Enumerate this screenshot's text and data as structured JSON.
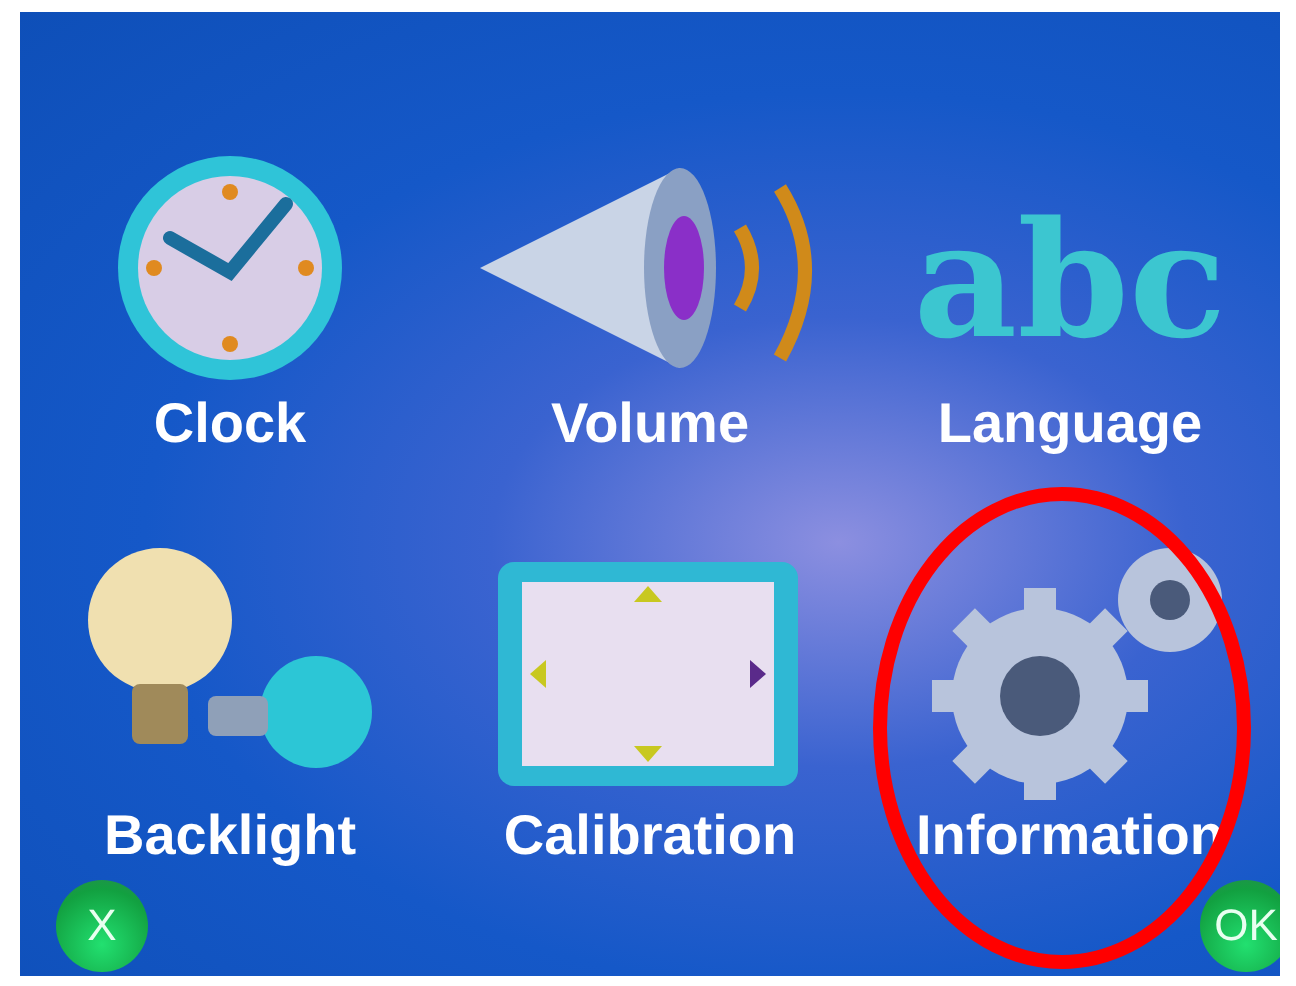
{
  "menu_items": [
    {
      "kind": "clock",
      "label": "Clock",
      "annotated": false
    },
    {
      "kind": "volume",
      "label": "Volume",
      "annotated": false
    },
    {
      "kind": "language",
      "label": "Language",
      "glyphs": "abc",
      "annotated": false
    },
    {
      "kind": "backlight",
      "label": "Backlight",
      "annotated": false
    },
    {
      "kind": "calibration",
      "label": "Calibration",
      "annotated": false
    },
    {
      "kind": "information",
      "label": "Information",
      "annotated": true
    }
  ],
  "buttons": [
    "X",
    "OK"
  ]
}
